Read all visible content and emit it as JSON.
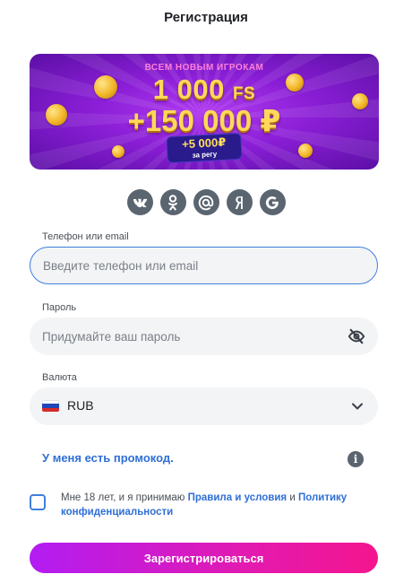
{
  "page": {
    "title": "Регистрация"
  },
  "banner": {
    "top_text": "ВСЕМ НОВЫМ ИГРОКАМ",
    "fs_amount": "1 000",
    "fs_unit": "FS",
    "rub_amount": "+150 000 ₽",
    "badge_amount": "+5 000₽",
    "badge_sub": "за регу"
  },
  "socials": [
    {
      "name": "vk-icon",
      "glyph": "vk"
    },
    {
      "name": "odnoklassniki-icon",
      "glyph": "ok"
    },
    {
      "name": "mail-icon",
      "glyph": "@"
    },
    {
      "name": "yandex-icon",
      "glyph": "Я"
    },
    {
      "name": "google-icon",
      "glyph": "G"
    }
  ],
  "form": {
    "login_label": "Телефон или email",
    "login_placeholder": "Введите телефон или email",
    "password_label": "Пароль",
    "password_placeholder": "Придумайте ваш пароль",
    "currency_label": "Валюта",
    "currency_value": "RUB",
    "promo_link": "У меня есть промокод.",
    "terms_prefix": "Мне 18 лет, и я принимаю ",
    "terms_link1": "Правила и условия",
    "terms_and": " и ",
    "terms_link2": "Политику конфиденциальности",
    "submit_label": "Зарегистрироваться"
  },
  "colors": {
    "accent": "#2f6fd6",
    "button_start": "#b21cf3",
    "button_end": "#f4158e",
    "icon_bg": "#5a6570"
  }
}
